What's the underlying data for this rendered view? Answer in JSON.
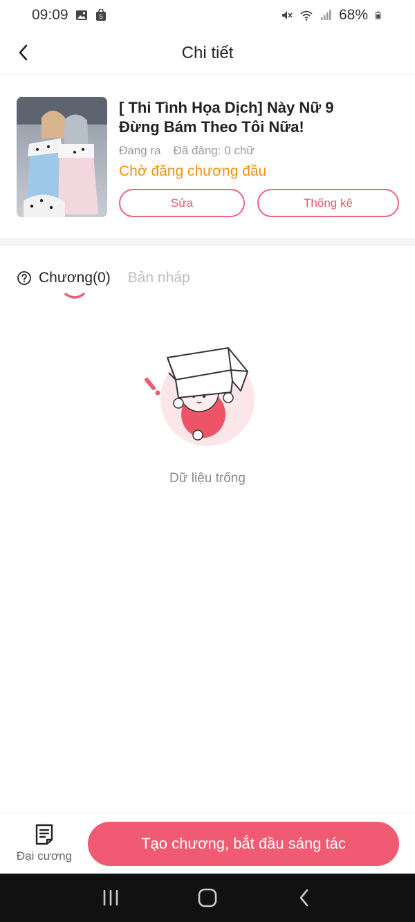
{
  "status_bar": {
    "time": "09:09",
    "battery": "68%",
    "left_icons": [
      "image-icon",
      "shopping-bag-icon"
    ],
    "right_icons": [
      "mute-icon",
      "wifi-icon",
      "signal-icon",
      "battery-icon"
    ]
  },
  "header": {
    "title": "Chi tiết",
    "back_icon": "chevron-left-icon"
  },
  "book": {
    "title": "[ Thi Tình Họa Dịch] Này Nữ 9 Đừng Bám Theo Tôi Nữa!",
    "status": "Đang ra",
    "word_count": "Đã đăng: 0 chữ",
    "pending_text": "Chờ đăng chương đầu",
    "edit_label": "Sửa",
    "stats_label": "Thống kê"
  },
  "tabs": {
    "chapters_label": "Chương(0)",
    "drafts_label": "Bản nháp"
  },
  "empty_state": {
    "text": "Dữ liệu trống"
  },
  "bottom_bar": {
    "outline_label": "Đại cương",
    "create_label": "Tạo chương, bắt đầu sáng tác"
  },
  "colors": {
    "accent": "#f05a72",
    "pending": "#f0920e"
  }
}
